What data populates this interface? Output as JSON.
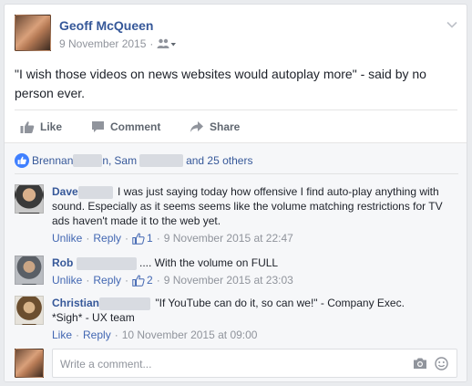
{
  "post": {
    "author": "Geoff McQueen",
    "date": "9 November 2015",
    "meta_separator": "·",
    "audience_icon": "friends-icon",
    "text": "\"I wish those videos on news websites would autoplay more\" - said by no person ever."
  },
  "actions": {
    "like": "Like",
    "comment": "Comment",
    "share": "Share"
  },
  "likes": {
    "liker1_visible": "Brennan",
    "liker1_suffix": "n,",
    "liker2_visible": "Sam",
    "and_others": "and 25 others"
  },
  "comments": [
    {
      "name": "Dave",
      "text": "I was just saying today how offensive I find auto-play anything with sound. Especially as it seems seems like the volume matching restrictions for TV ads haven't made it to the web yet.",
      "unlike": "Unlike",
      "reply": "Reply",
      "likes": "1",
      "date": "9 November 2015 at 22:47",
      "avatar_colors": [
        "#3a3a3a",
        "#c9c9c9"
      ]
    },
    {
      "name": "Rob",
      "text": ".... With the volume on FULL",
      "unlike": "Unlike",
      "reply": "Reply",
      "likes": "2",
      "date": "9 November 2015 at 23:03",
      "avatar_colors": [
        "#5a5f66",
        "#b9bcc1"
      ]
    },
    {
      "name": "Christian",
      "text": "\"If YouTube can do it, so can we!\" - Company Exec.",
      "text2": "*Sigh* - UX team",
      "like": "Like",
      "reply": "Reply",
      "date": "10 November 2015 at 09:00",
      "avatar_colors": [
        "#6b4e2f",
        "#d8b48a"
      ]
    }
  ],
  "write_comment": {
    "placeholder": "Write a comment..."
  },
  "colors": {
    "link": "#365899",
    "action_link": "#4267b2",
    "meta": "#90949c",
    "like_blue": "#4080ff"
  }
}
